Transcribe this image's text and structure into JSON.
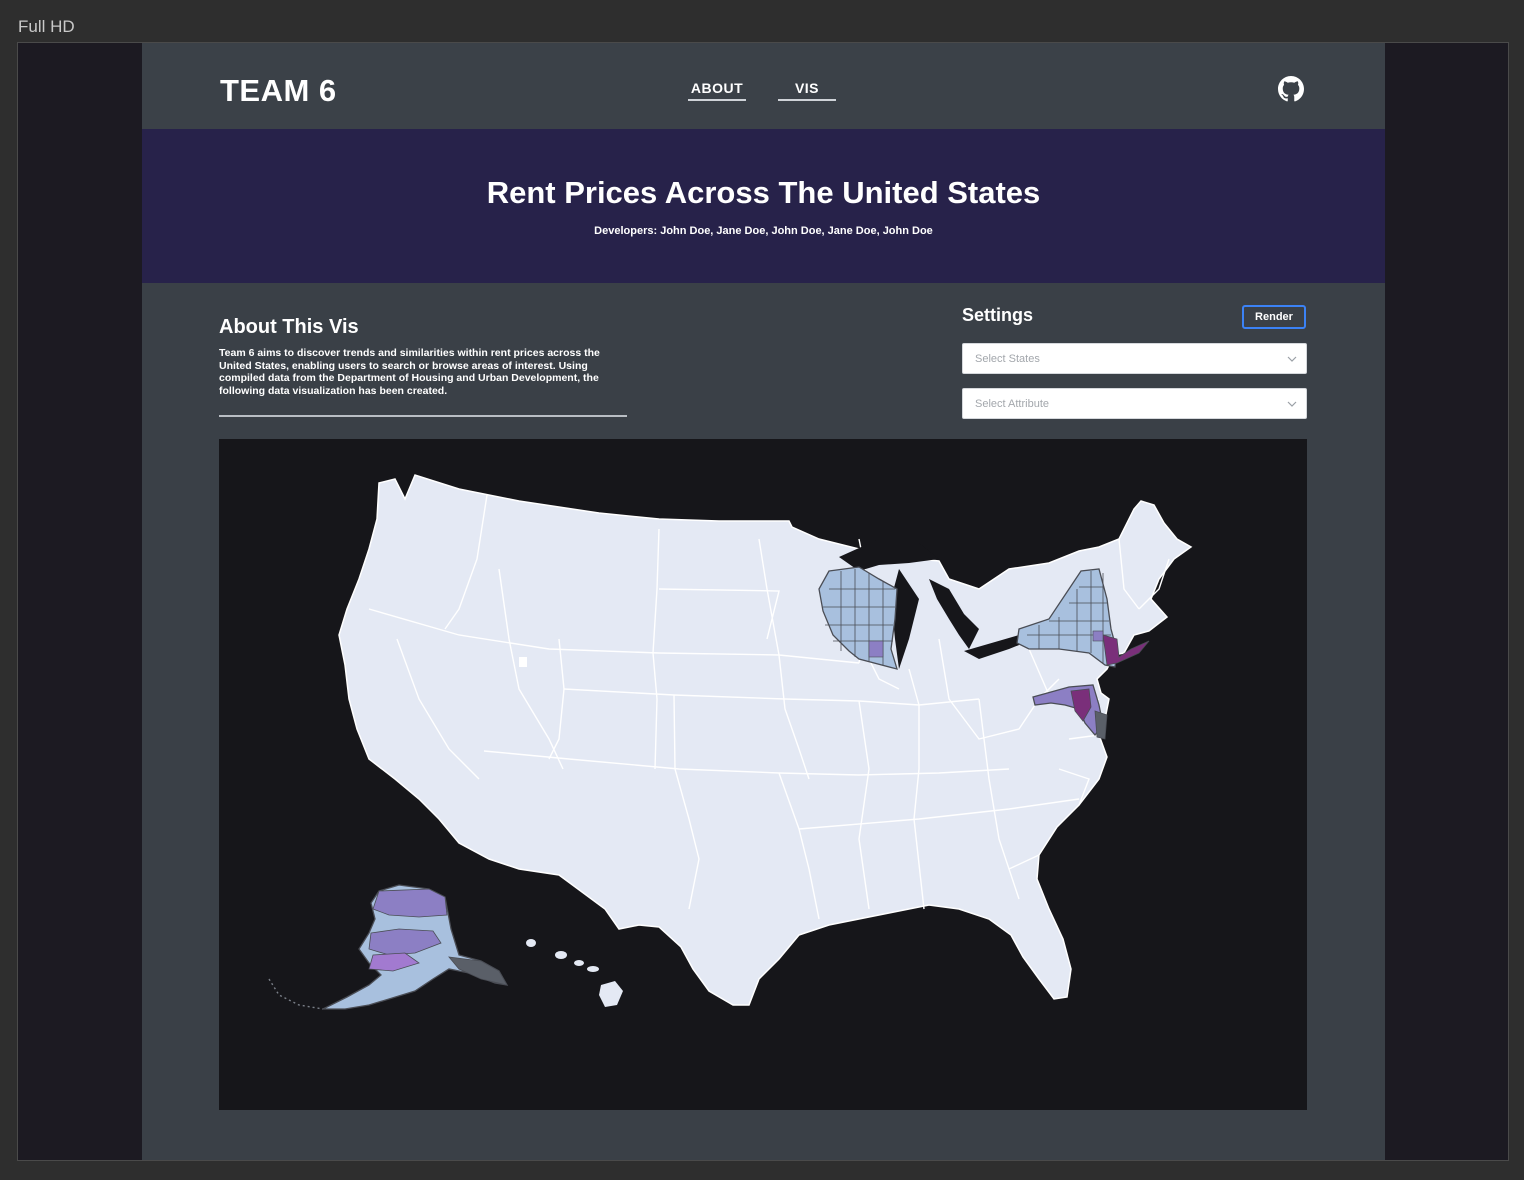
{
  "frame": {
    "label": "Full HD"
  },
  "navbar": {
    "brand": "TEAM 6",
    "links": [
      {
        "label": "ABOUT"
      },
      {
        "label": "VIS"
      }
    ],
    "github_icon": "github-icon"
  },
  "hero": {
    "title": "Rent Prices Across The United States",
    "developers": "Developers: John Doe, Jane Doe, John Doe, Jane Doe, John Doe"
  },
  "about": {
    "heading": "About This Vis",
    "body": "Team 6 aims to discover trends and similarities within rent prices across the United States, enabling users to search or browse areas of interest. Using compiled data from the Department of Housing and Urban Development, the following data visualization has been created."
  },
  "settings": {
    "heading": "Settings",
    "render_label": "Render",
    "states_select": {
      "placeholder": "Select States"
    },
    "attribute_select": {
      "placeholder": "Select Attribute"
    }
  },
  "map": {
    "colors": {
      "land": "#e4e9f4",
      "state_border": "#ffffff",
      "county_light": "#a8c0de",
      "county_mid": "#8c7fc4",
      "county_dark": "#7a2f7a",
      "county_border": "#4a4d55",
      "background": "#16161a"
    },
    "highlighted_states": [
      "Wisconsin",
      "New York",
      "Maryland",
      "Alaska"
    ]
  },
  "colors": {
    "page_bg": "#3a4047",
    "hero_bg": "#27224a",
    "accent_button_border": "#3b82f6"
  }
}
